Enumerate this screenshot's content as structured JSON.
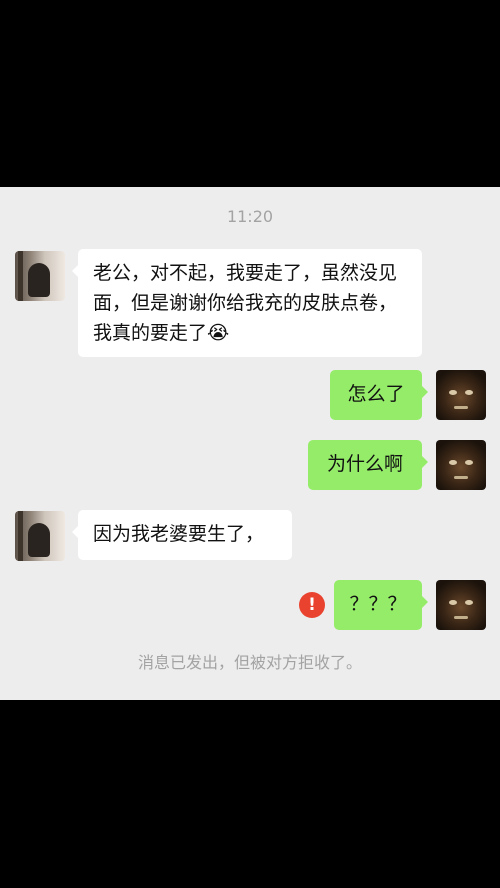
{
  "chat": {
    "timestamp": "11:20",
    "messages": [
      {
        "sender": "contact",
        "text": "老公，对不起，我要走了，虽然没见面，但是谢谢你给我充的皮肤点卷，我真的要走了😭"
      },
      {
        "sender": "me",
        "text": "怎么了"
      },
      {
        "sender": "me",
        "text": "为什么啊"
      },
      {
        "sender": "contact",
        "text": "因为我老婆要生了，"
      },
      {
        "sender": "me",
        "text": "？？？",
        "status": "failed"
      }
    ],
    "failed_icon_glyph": "!",
    "system_note": "消息已发出，但被对方拒收了。"
  },
  "icons": {
    "failed": "exclamation-circle-icon",
    "contact_avatar": "woman-silhouette-avatar",
    "my_avatar": "man-portrait-avatar"
  },
  "colors": {
    "chat_background": "#ededed",
    "incoming_bubble": "#ffffff",
    "outgoing_bubble": "#95ec69",
    "error": "#e9432f",
    "meta_text": "#a3a3a3",
    "frame": "#000000"
  }
}
